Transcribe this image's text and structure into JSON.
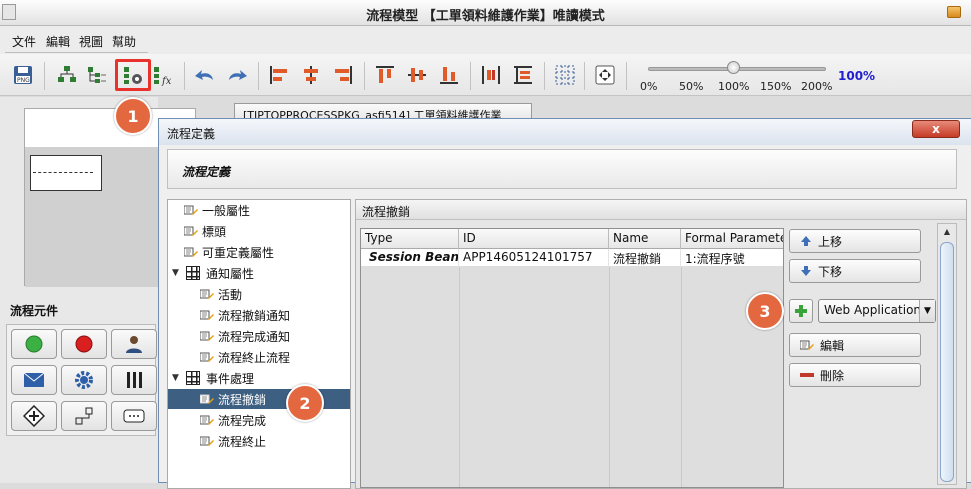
{
  "window": {
    "title": "流程模型 【工單領料維護作業】唯讀模式"
  },
  "menu": [
    "文件",
    "編輯",
    "視圖",
    "幫助"
  ],
  "toolbar": {
    "buttons": [
      {
        "name": "export-png-button",
        "icon": "png-save-icon"
      },
      {
        "name": "tree-layout-button",
        "icon": "hierarchy-icon"
      },
      {
        "name": "list-layout-button",
        "icon": "list-tree-icon"
      },
      {
        "name": "process-settings-button",
        "icon": "gear-tree-icon"
      },
      {
        "name": "formula-button",
        "icon": "fx-tree-icon"
      },
      {
        "name": "undo-button",
        "icon": "undo-icon"
      },
      {
        "name": "redo-button",
        "icon": "redo-icon"
      },
      {
        "name": "align-left-button",
        "icon": "align-left-icon"
      },
      {
        "name": "align-center-button",
        "icon": "align-center-icon"
      },
      {
        "name": "align-right-button",
        "icon": "align-right-icon"
      },
      {
        "name": "align-top-button",
        "icon": "align-top-icon"
      },
      {
        "name": "align-middle-button",
        "icon": "align-middle-icon"
      },
      {
        "name": "align-bottom-button",
        "icon": "align-bottom-icon"
      },
      {
        "name": "distribute-horizontal-button",
        "icon": "distribute-h-icon"
      },
      {
        "name": "distribute-vertical-button",
        "icon": "distribute-v-icon"
      },
      {
        "name": "grid-button",
        "icon": "grid-icon"
      },
      {
        "name": "fit-screen-button",
        "icon": "fit-icon"
      }
    ],
    "zoom_ticks": [
      "0%",
      "50%",
      "100%",
      "150%",
      "200%"
    ],
    "zoom_value": "100%",
    "zoom_level": 0.5
  },
  "left": {
    "palette_title": "流程元件",
    "palette_items": [
      "start-icon",
      "end-icon",
      "user-task-icon",
      "mail-icon",
      "gear-icon",
      "parallel-icon",
      "gateway-icon",
      "flow-icon",
      "script-icon"
    ]
  },
  "doc_tab": "[TIPTOPPROCESSPKG_asfi514] 工單領料維護作業",
  "dialog": {
    "title": "流程定義",
    "close_label": "x",
    "header": "流程定義",
    "tree": [
      {
        "label": "一般屬性",
        "level": 1,
        "kind": "leaf"
      },
      {
        "label": "標頭",
        "level": 1,
        "kind": "leaf"
      },
      {
        "label": "可重定義屬性",
        "level": 1,
        "kind": "leaf"
      },
      {
        "label": "通知屬性",
        "level": 0,
        "kind": "folder"
      },
      {
        "label": "活動",
        "level": 2,
        "kind": "leaf"
      },
      {
        "label": "流程撤銷通知",
        "level": 2,
        "kind": "leaf"
      },
      {
        "label": "流程完成通知",
        "level": 2,
        "kind": "leaf"
      },
      {
        "label": "流程終止流程",
        "level": 2,
        "kind": "leaf"
      },
      {
        "label": "事件處理",
        "level": 0,
        "kind": "folder"
      },
      {
        "label": "流程撤銷",
        "level": 2,
        "kind": "leaf",
        "selected": true
      },
      {
        "label": "流程完成",
        "level": 2,
        "kind": "leaf"
      },
      {
        "label": "流程終止",
        "level": 2,
        "kind": "leaf"
      }
    ],
    "panel_title": "流程撤銷",
    "table": {
      "columns": [
        "Type",
        "ID",
        "Name",
        "Formal Paramete"
      ],
      "rows": [
        [
          "Session Bean",
          "APP14605124101757",
          "流程撤銷",
          "1:流程序號"
        ]
      ]
    },
    "buttons": {
      "up": "上移",
      "down": "下移",
      "edit": "編輯",
      "delete": "刪除"
    },
    "app_type": "Web Application"
  },
  "callouts": [
    "1",
    "2",
    "3"
  ],
  "colors": {
    "callout": "#e3683f",
    "highlight": "#e8322b",
    "tree_selected": "#3d5f82",
    "zoom_value": "#1f1fd0"
  }
}
